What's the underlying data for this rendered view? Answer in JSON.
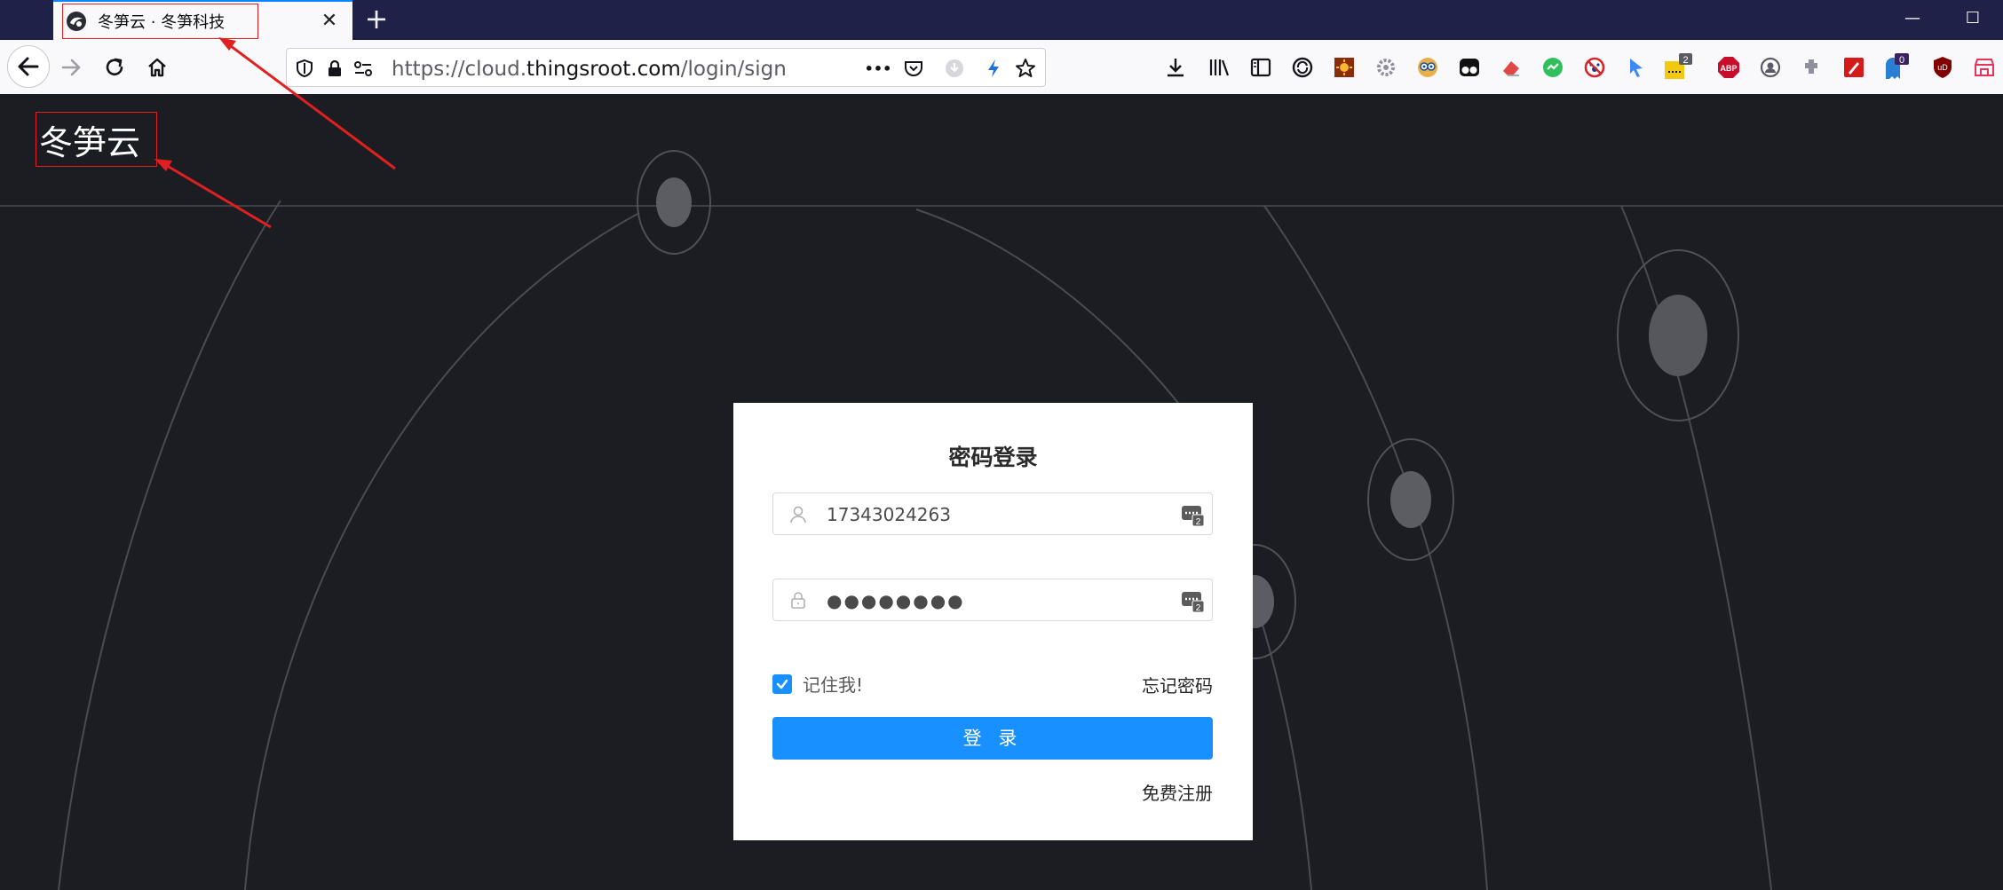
{
  "browser": {
    "tab_title": "冬笋云 · 冬笋科技",
    "close_glyph": "✕",
    "new_tab_glyph": "+",
    "minimize_glyph": "—",
    "maximize_glyph": "☐",
    "url_prefix": "https://cloud.",
    "url_host": "thingsroot.com",
    "url_path": "/login/sign",
    "more_glyph": "•••",
    "toolbar_badges": {
      "dev_count": "2",
      "ghost_count": "0",
      "abp": "ABP",
      "ud": "uD"
    }
  },
  "site": {
    "logo_text": "冬笋云"
  },
  "login": {
    "title": "密码登录",
    "username_value": "17343024263",
    "password_dots": "●●●●●●●●",
    "remember_label": "记住我!",
    "forgot_label": "忘记密码",
    "login_button": "登 录",
    "register_label": "免费注册"
  },
  "colors": {
    "primary": "#1890ff",
    "page_bg": "#1c1d23",
    "annotation": "#e02020",
    "titlebar": "#1f2148"
  }
}
